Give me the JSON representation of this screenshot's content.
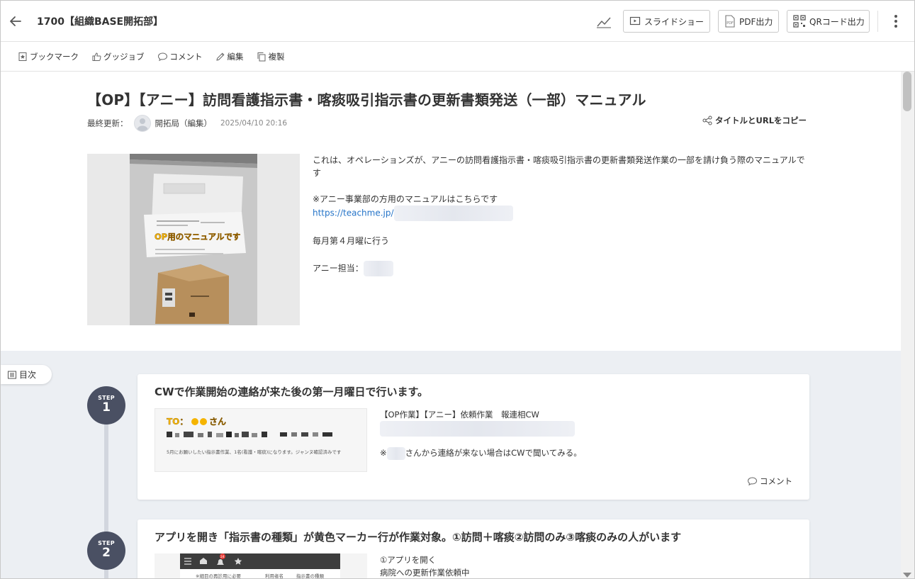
{
  "header": {
    "title": "1700【組織BASE開拓部】",
    "slideshow_label": "スライドショー",
    "pdf_label": "PDF出力",
    "qr_label": "QRコード出力"
  },
  "toolbar": {
    "bookmark": "ブックマーク",
    "goodjob": "グッジョブ",
    "comment": "コメント",
    "edit": "編集",
    "duplicate": "複製"
  },
  "doc": {
    "title": "【OP】【アニー】訪問看護指示書・喀痰吸引指示書の更新書類発送（一部）マニュアル",
    "last_updated_label": "最終更新：",
    "author": "開拓局（編集）",
    "updated_at": "2025/04/10 20:16",
    "copy_link": "タイトルとURLをコピー",
    "hero_caption": "OP用のマニュアルです",
    "intro_line1": "これは、オペレーションズが、アニーの訪問看護指示書・喀痰吸引指示書の更新書類発送作業の一部を請け負う際のマニュアルです",
    "intro_line2": "※アニー事業部の方用のマニュアルはこちらです",
    "intro_link": "https://teachme.jp/",
    "intro_line3": "毎月第４月曜に行う",
    "intro_line4": "アニー担当："
  },
  "toc_label": "目次",
  "steps": [
    {
      "step_label": "STEP",
      "number": "1",
      "title": "CWで作業開始の連絡が来た後の第一月曜日で行います。",
      "img_to": "TO：",
      "img_name": "さん",
      "img_note": "5月にお願いしたい指示書作業、1名(看護・喀痰)になります。ジャンヌ確認済みです",
      "text1": "【OP作業】【アニー】依頼作業　報連相CW",
      "text2_prefix": "※",
      "text2_suffix": "さんから連絡が来ない場合はCWで聞いてみる。",
      "comment": "コメント"
    },
    {
      "step_label": "STEP",
      "number": "2",
      "title": "アプリを開き「指示書の種類」が黄色マーカー行が作業対象。①訪問＋喀痰②訪問のみ③喀痰のみの人がいます",
      "text1": "①アプリを開く",
      "text2": "病院への更新作業依頼中",
      "img_badge": "24",
      "img_col1": "※細目の再診用に必要",
      "img_col2": "利用者名",
      "img_col3": "指示書の種類"
    }
  ],
  "colors": {
    "link": "#2574c8",
    "step_circle": "#4a5063",
    "gray_area": "#eceff3",
    "marker_yellow": "#f5b400"
  }
}
